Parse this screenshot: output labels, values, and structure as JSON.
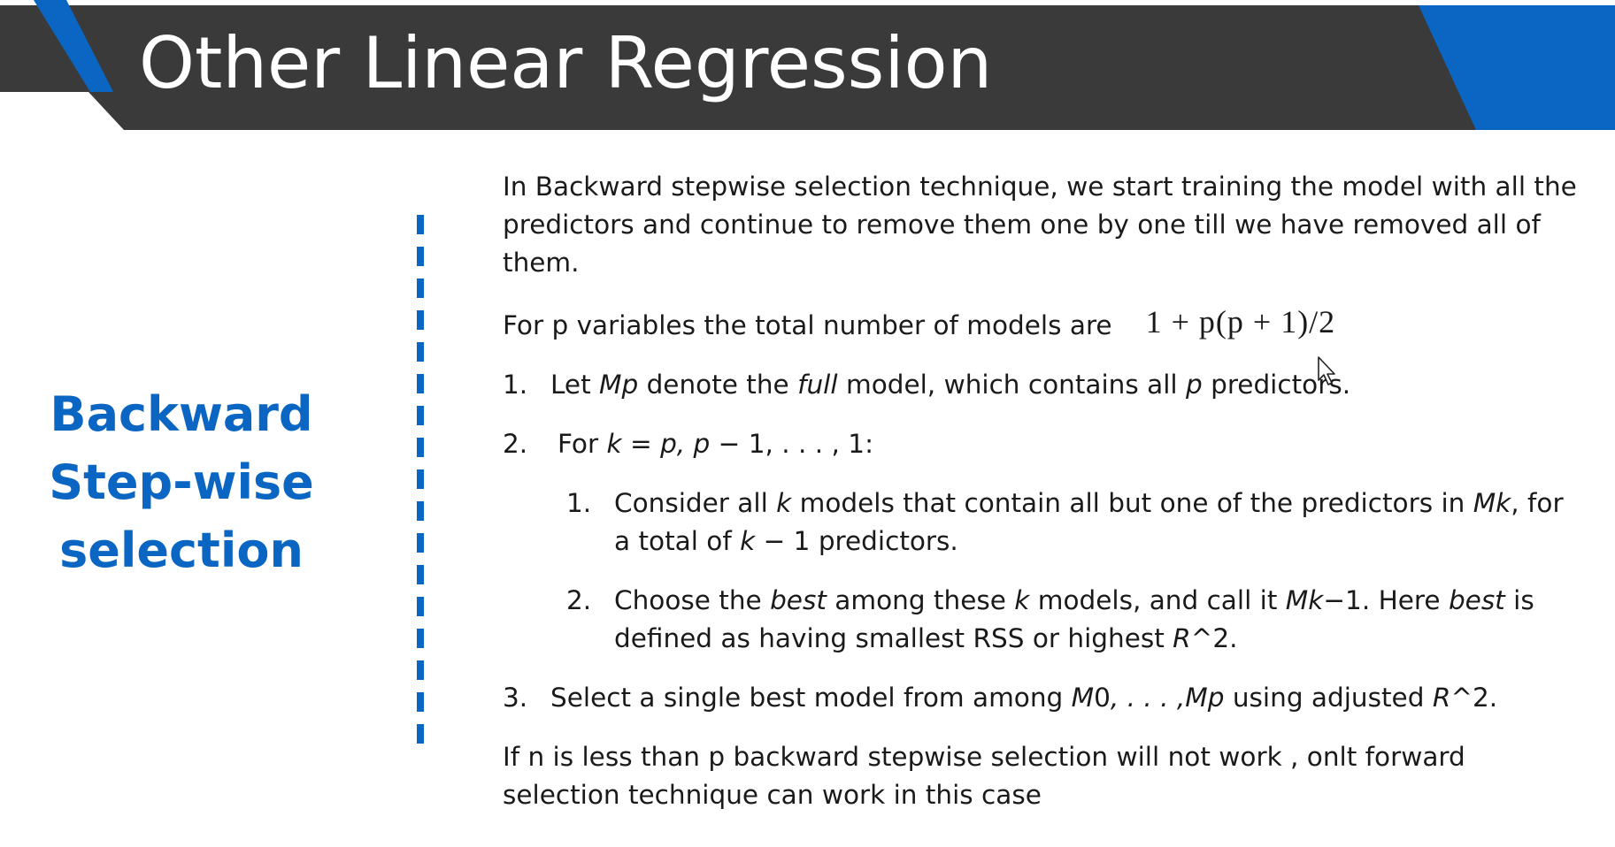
{
  "header": {
    "title": "Other Linear Regression",
    "colors": {
      "banner": "#3a3a3a",
      "accent": "#0a66c2"
    }
  },
  "side_label": {
    "lines": [
      "Backward",
      "Step-wise",
      "selection"
    ],
    "color": "#0a66c2"
  },
  "content": {
    "intro": "In Backward stepwise selection technique, we start training the model with all the predictors and continue to remove them one by one till we have removed all of them.",
    "formula_text": "For p variables the total number of models are",
    "formula": "1 + p(p + 1)/2",
    "step1": {
      "num": "1.",
      "t1": "Let ",
      "i1": "Mp",
      "t2": " denote the ",
      "i2": "full",
      "t3": " model, which contains all ",
      "i3": "p",
      "t4": " predictors."
    },
    "step2": {
      "num": "2.",
      "t1": "For ",
      "i1": "k",
      "t2": " = ",
      "i2": "p, p",
      "t3": " − 1, . . . , 1:"
    },
    "substep1": {
      "num": "1.",
      "t1": "Consider all ",
      "i1": "k",
      "t2": " models that contain all but one of the predictors in ",
      "i2": "Mk",
      "t3": ", for a total of ",
      "i3": "k",
      "t4": " − 1 predictors."
    },
    "substep2": {
      "num": "2.",
      "t1": "Choose the ",
      "i1": "best",
      "t2": " among these ",
      "i2": "k",
      "t3": " models, and call it ",
      "i3": "Mk",
      "t4": "−1. Here ",
      "i4": "best",
      "t5": " is defined as having smallest RSS or highest ",
      "i5": "R",
      "t6": "^2."
    },
    "step3": {
      "num": "3.",
      "t1": "Select a single best model from among ",
      "i1": "M",
      "t2": "0",
      "i2": ", . . . ,Mp",
      "t3": " using adjusted ",
      "i3": "R",
      "t4": "^2."
    },
    "note": "If n is less than p backward stepwise selection will not work , onlt forward selection technique can work in this case"
  }
}
